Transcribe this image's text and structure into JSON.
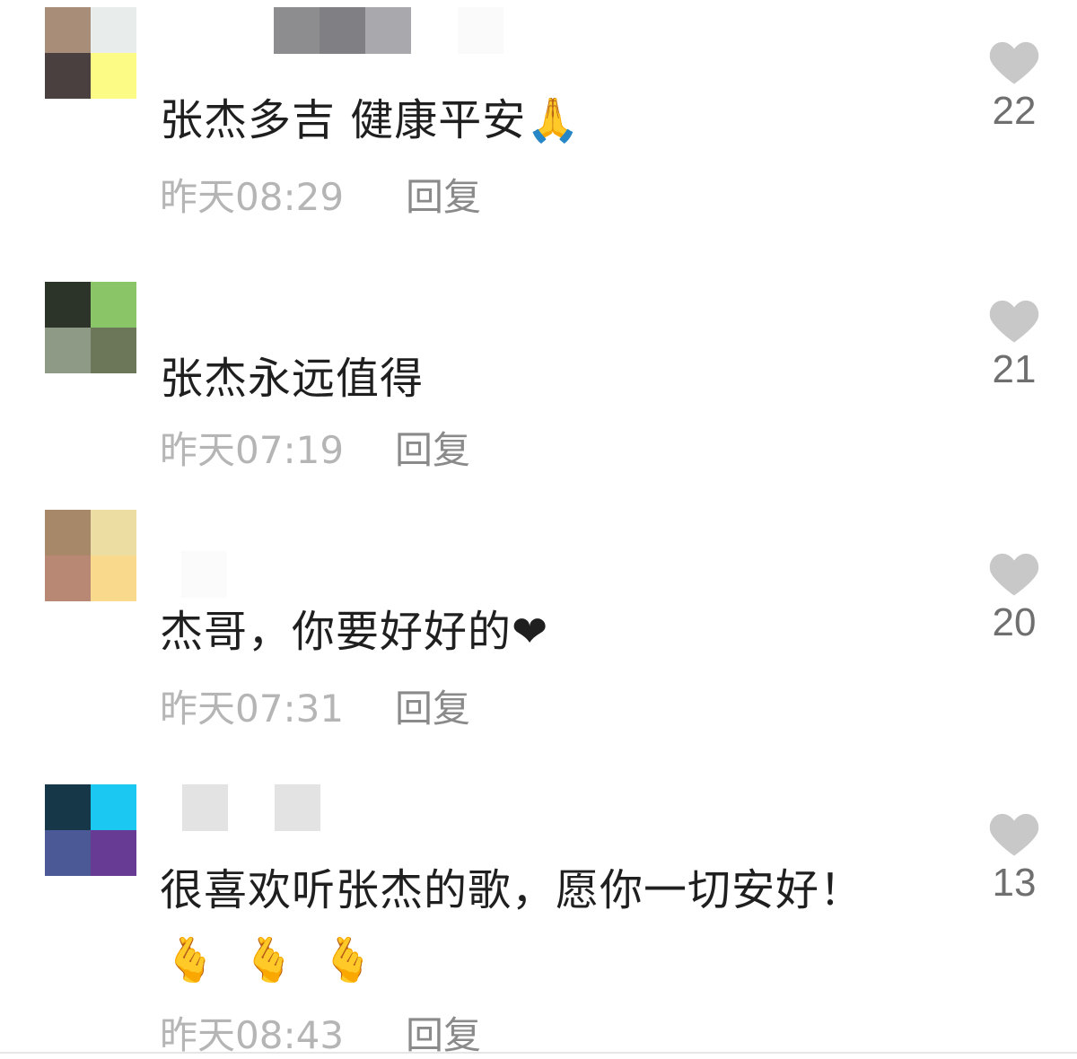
{
  "comments": [
    {
      "text": "张杰多吉 健康平安🙏",
      "time": "昨天08:29",
      "reply": "回复",
      "likes": "22",
      "avatar_colors": [
        "#a88e79",
        "#e8ecea",
        "#4a4040",
        "#fbfb85"
      ],
      "name_colors": [
        "#ffffff",
        "#8d8d8f",
        "#808084",
        "#a9a9ad"
      ]
    },
    {
      "text": "张杰永远值得",
      "time": "昨天07:19",
      "reply": "回复",
      "likes": "21",
      "avatar_colors": [
        "#2c3329",
        "#8ac667",
        "#8e9a86",
        "#6c7658"
      ],
      "name_colors": []
    },
    {
      "text": "杰哥，你要好好的❤",
      "time": "昨天07:31",
      "reply": "回复",
      "likes": "20",
      "avatar_colors": [
        "#a7896a",
        "#ecdda2",
        "#b98874",
        "#f9d98b"
      ],
      "name_colors": []
    },
    {
      "text": "很喜欢听张杰的歌，愿你一切安好！",
      "emojis": "🫰🫰🫰",
      "time": "昨天08:43",
      "reply": "回复",
      "likes": "13",
      "avatar_colors": [
        "#163747",
        "#1bc8f2",
        "#4b5a97",
        "#673a93"
      ],
      "name_colors": [
        "#e3e3e3",
        "#e3e3e3"
      ]
    }
  ],
  "icons": {
    "like": "heart-icon"
  },
  "colors": {
    "heart": "#c8c8c8",
    "text": "#1f1f1f",
    "meta": "#b5b5b5",
    "reply": "#8a8a8a",
    "count": "#6f6f6f"
  }
}
